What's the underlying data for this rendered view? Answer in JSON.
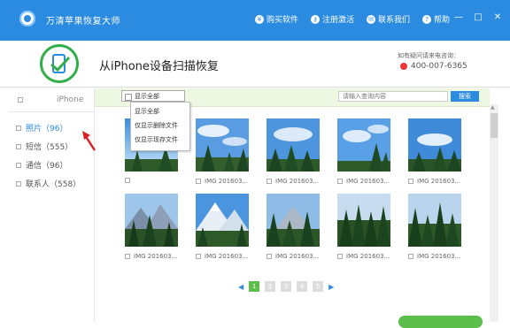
{
  "titlebar": {
    "app_title": "万清苹果恢复大师",
    "links": [
      {
        "icon": "purchase-icon",
        "glyph": "¥",
        "label": "购买软件"
      },
      {
        "icon": "key-icon",
        "glyph": "⚷",
        "label": "注册激活"
      },
      {
        "icon": "mail-icon",
        "glyph": "✉",
        "label": "联系我们"
      },
      {
        "icon": "help-icon",
        "glyph": "?",
        "label": "帮助"
      }
    ],
    "window_buttons": {
      "minimize": "—",
      "maximize": "□",
      "close": "✕"
    }
  },
  "header": {
    "title": "从iPhone设备扫描恢复",
    "contact_label": "如有疑问请来电咨询：",
    "phone": "400-007-6365"
  },
  "sidebar": {
    "header": "iPhone",
    "items": [
      {
        "label": "照片（96）",
        "active": true
      },
      {
        "label": "短信（555）",
        "active": false
      },
      {
        "label": "通信（96）",
        "active": false
      },
      {
        "label": "联系人（558）",
        "active": false
      }
    ]
  },
  "toolbar": {
    "filter_selected": "显示全部",
    "filter_options": [
      "显示全部",
      "仅显示删除文件",
      "仅显示现存文件"
    ],
    "search_placeholder": "请输入查询内容",
    "search_button": "搜索"
  },
  "photos": {
    "captions": [
      "",
      "IMG 201603...",
      "IMG 201603...",
      "IMG 201603...",
      "IMG 201603...",
      "IMG 201603...",
      "IMG 201603...",
      "IMG 201603...",
      "IMG 201603...",
      "IMG 201603..."
    ]
  },
  "pagination": {
    "prev": "◀",
    "next": "▶",
    "pages": [
      "1",
      "2",
      "3",
      "4",
      "5"
    ],
    "current": "1"
  },
  "colors": {
    "brand_blue": "#2a8be0",
    "accent_green": "#5bbd4a",
    "arrow_red": "#d62222"
  }
}
